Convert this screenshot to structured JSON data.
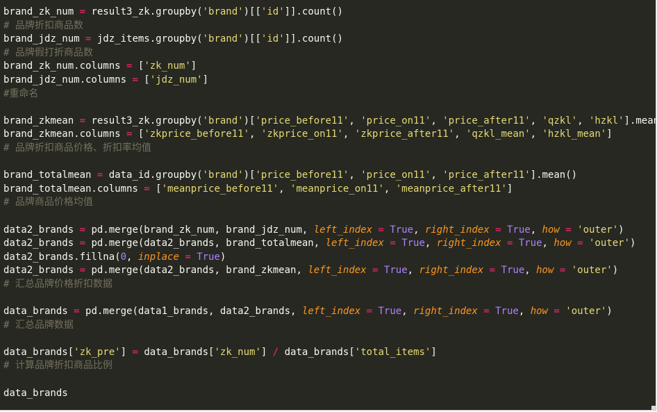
{
  "editor": {
    "colors": {
      "background": "#272822",
      "text": "#f8f8f2",
      "operator": "#f92672",
      "string": "#e6db74",
      "number": "#ae81ff",
      "keyword_arg": "#fd971f",
      "comment": "#75715e"
    },
    "lines": [
      [
        [
          "text",
          "brand_zk_num "
        ],
        [
          "op",
          "="
        ],
        [
          "text",
          " result3_zk.groupby("
        ],
        [
          "str",
          "'brand'"
        ],
        [
          "text",
          ")[["
        ],
        [
          "str",
          "'id'"
        ],
        [
          "text",
          "]].count()"
        ]
      ],
      [
        [
          "comment",
          "# 品牌折扣商品数"
        ]
      ],
      [
        [
          "text",
          "brand_jdz_num "
        ],
        [
          "op",
          "="
        ],
        [
          "text",
          " jdz_items.groupby("
        ],
        [
          "str",
          "'brand'"
        ],
        [
          "text",
          ")[["
        ],
        [
          "str",
          "'id'"
        ],
        [
          "text",
          "]].count()"
        ]
      ],
      [
        [
          "comment",
          "# 品牌假打折商品数"
        ]
      ],
      [
        [
          "text",
          "brand_zk_num.columns "
        ],
        [
          "op",
          "="
        ],
        [
          "text",
          " ["
        ],
        [
          "str",
          "'zk_num'"
        ],
        [
          "text",
          "]"
        ]
      ],
      [
        [
          "text",
          "brand_jdz_num.columns "
        ],
        [
          "op",
          "="
        ],
        [
          "text",
          " ["
        ],
        [
          "str",
          "'jdz_num'"
        ],
        [
          "text",
          "]"
        ]
      ],
      [
        [
          "comment",
          "#重命名"
        ]
      ],
      [],
      [
        [
          "text",
          "brand_zkmean "
        ],
        [
          "op",
          "="
        ],
        [
          "text",
          " result3_zk.groupby("
        ],
        [
          "str",
          "'brand'"
        ],
        [
          "text",
          ")["
        ],
        [
          "str",
          "'price_before11'"
        ],
        [
          "text",
          ", "
        ],
        [
          "str",
          "'price_on11'"
        ],
        [
          "text",
          ", "
        ],
        [
          "str",
          "'price_after11'"
        ],
        [
          "text",
          ", "
        ],
        [
          "str",
          "'qzkl'"
        ],
        [
          "text",
          ", "
        ],
        [
          "str",
          "'hzkl'"
        ],
        [
          "text",
          "].mean()"
        ]
      ],
      [
        [
          "text",
          "brand_zkmean.columns "
        ],
        [
          "op",
          "="
        ],
        [
          "text",
          " ["
        ],
        [
          "str",
          "'zkprice_before11'"
        ],
        [
          "text",
          ", "
        ],
        [
          "str",
          "'zkprice_on11'"
        ],
        [
          "text",
          ", "
        ],
        [
          "str",
          "'zkprice_after11'"
        ],
        [
          "text",
          ", "
        ],
        [
          "str",
          "'qzkl_mean'"
        ],
        [
          "text",
          ", "
        ],
        [
          "str",
          "'hzkl_mean'"
        ],
        [
          "text",
          "]"
        ]
      ],
      [
        [
          "comment",
          "# 品牌折扣商品价格、折扣率均值"
        ]
      ],
      [],
      [
        [
          "text",
          "brand_totalmean "
        ],
        [
          "op",
          "="
        ],
        [
          "text",
          " data_id.groupby("
        ],
        [
          "str",
          "'brand'"
        ],
        [
          "text",
          ")["
        ],
        [
          "str",
          "'price_before11'"
        ],
        [
          "text",
          ", "
        ],
        [
          "str",
          "'price_on11'"
        ],
        [
          "text",
          ", "
        ],
        [
          "str",
          "'price_after11'"
        ],
        [
          "text",
          "].mean()"
        ]
      ],
      [
        [
          "text",
          "brand_totalmean.columns "
        ],
        [
          "op",
          "="
        ],
        [
          "text",
          " ["
        ],
        [
          "str",
          "'meanprice_before11'"
        ],
        [
          "text",
          ", "
        ],
        [
          "str",
          "'meanprice_on11'"
        ],
        [
          "text",
          ", "
        ],
        [
          "str",
          "'meanprice_after11'"
        ],
        [
          "text",
          "]"
        ]
      ],
      [
        [
          "comment",
          "# 品牌商品价格均值"
        ]
      ],
      [],
      [
        [
          "text",
          "data2_brands "
        ],
        [
          "op",
          "="
        ],
        [
          "text",
          " pd.merge(brand_zk_num, brand_jdz_num, "
        ],
        [
          "kw",
          "left_index"
        ],
        [
          "text",
          " "
        ],
        [
          "op",
          "="
        ],
        [
          "text",
          " "
        ],
        [
          "const",
          "True"
        ],
        [
          "text",
          ", "
        ],
        [
          "kw",
          "right_index"
        ],
        [
          "text",
          " "
        ],
        [
          "op",
          "="
        ],
        [
          "text",
          " "
        ],
        [
          "const",
          "True"
        ],
        [
          "text",
          ", "
        ],
        [
          "kw",
          "how"
        ],
        [
          "text",
          " "
        ],
        [
          "op",
          "="
        ],
        [
          "text",
          " "
        ],
        [
          "str",
          "'outer'"
        ],
        [
          "text",
          ")"
        ]
      ],
      [
        [
          "text",
          "data2_brands "
        ],
        [
          "op",
          "="
        ],
        [
          "text",
          " pd.merge(data2_brands, brand_totalmean, "
        ],
        [
          "kw",
          "left_index"
        ],
        [
          "text",
          " "
        ],
        [
          "op",
          "="
        ],
        [
          "text",
          " "
        ],
        [
          "const",
          "True"
        ],
        [
          "text",
          ", "
        ],
        [
          "kw",
          "right_index"
        ],
        [
          "text",
          " "
        ],
        [
          "op",
          "="
        ],
        [
          "text",
          " "
        ],
        [
          "const",
          "True"
        ],
        [
          "text",
          ", "
        ],
        [
          "kw",
          "how"
        ],
        [
          "text",
          " "
        ],
        [
          "op",
          "="
        ],
        [
          "text",
          " "
        ],
        [
          "str",
          "'outer'"
        ],
        [
          "text",
          ")"
        ]
      ],
      [
        [
          "text",
          "data2_brands.fillna("
        ],
        [
          "num",
          "0"
        ],
        [
          "text",
          ", "
        ],
        [
          "kw",
          "inplace"
        ],
        [
          "text",
          " "
        ],
        [
          "op",
          "="
        ],
        [
          "text",
          " "
        ],
        [
          "const",
          "True"
        ],
        [
          "text",
          ")"
        ]
      ],
      [
        [
          "text",
          "data2_brands "
        ],
        [
          "op",
          "="
        ],
        [
          "text",
          " pd.merge(data2_brands, brand_zkmean, "
        ],
        [
          "kw",
          "left_index"
        ],
        [
          "text",
          " "
        ],
        [
          "op",
          "="
        ],
        [
          "text",
          " "
        ],
        [
          "const",
          "True"
        ],
        [
          "text",
          ", "
        ],
        [
          "kw",
          "right_index"
        ],
        [
          "text",
          " "
        ],
        [
          "op",
          "="
        ],
        [
          "text",
          " "
        ],
        [
          "const",
          "True"
        ],
        [
          "text",
          ", "
        ],
        [
          "kw",
          "how"
        ],
        [
          "text",
          " "
        ],
        [
          "op",
          "="
        ],
        [
          "text",
          " "
        ],
        [
          "str",
          "'outer'"
        ],
        [
          "text",
          ")"
        ]
      ],
      [
        [
          "comment",
          "# 汇总品牌价格折扣数据"
        ]
      ],
      [],
      [
        [
          "text",
          "data_brands "
        ],
        [
          "op",
          "="
        ],
        [
          "text",
          " pd.merge(data1_brands, data2_brands, "
        ],
        [
          "kw",
          "left_index"
        ],
        [
          "text",
          " "
        ],
        [
          "op",
          "="
        ],
        [
          "text",
          " "
        ],
        [
          "const",
          "True"
        ],
        [
          "text",
          ", "
        ],
        [
          "kw",
          "right_index"
        ],
        [
          "text",
          " "
        ],
        [
          "op",
          "="
        ],
        [
          "text",
          " "
        ],
        [
          "const",
          "True"
        ],
        [
          "text",
          ", "
        ],
        [
          "kw",
          "how"
        ],
        [
          "text",
          " "
        ],
        [
          "op",
          "="
        ],
        [
          "text",
          " "
        ],
        [
          "str",
          "'outer'"
        ],
        [
          "text",
          ")"
        ]
      ],
      [
        [
          "comment",
          "# 汇总品牌数据"
        ]
      ],
      [],
      [
        [
          "text",
          "data_brands["
        ],
        [
          "str",
          "'zk_pre'"
        ],
        [
          "text",
          "] "
        ],
        [
          "op",
          "="
        ],
        [
          "text",
          " data_brands["
        ],
        [
          "str",
          "'zk_num'"
        ],
        [
          "text",
          "] "
        ],
        [
          "op",
          "/"
        ],
        [
          "text",
          " data_brands["
        ],
        [
          "str",
          "'total_items'"
        ],
        [
          "text",
          "]"
        ]
      ],
      [
        [
          "comment",
          "# 计算品牌折扣商品比例"
        ]
      ],
      [],
      [
        [
          "text",
          "data_brands"
        ]
      ]
    ]
  }
}
